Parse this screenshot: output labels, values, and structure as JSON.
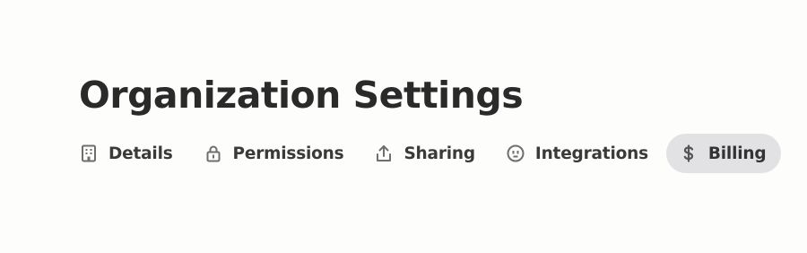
{
  "header": {
    "title": "Organization Settings"
  },
  "tabs": [
    {
      "label": "Details",
      "icon": "building-icon",
      "active": false
    },
    {
      "label": "Permissions",
      "icon": "lock-icon",
      "active": false
    },
    {
      "label": "Sharing",
      "icon": "share-upload-icon",
      "active": false
    },
    {
      "label": "Integrations",
      "icon": "plug-outlet-icon",
      "active": false
    },
    {
      "label": "Billing",
      "icon": "dollar-icon",
      "active": true
    }
  ],
  "colors": {
    "active_tab_background": "#e2e2e4",
    "icon_gray": "#6e6e6e",
    "text_dark": "#2b2b2b"
  }
}
